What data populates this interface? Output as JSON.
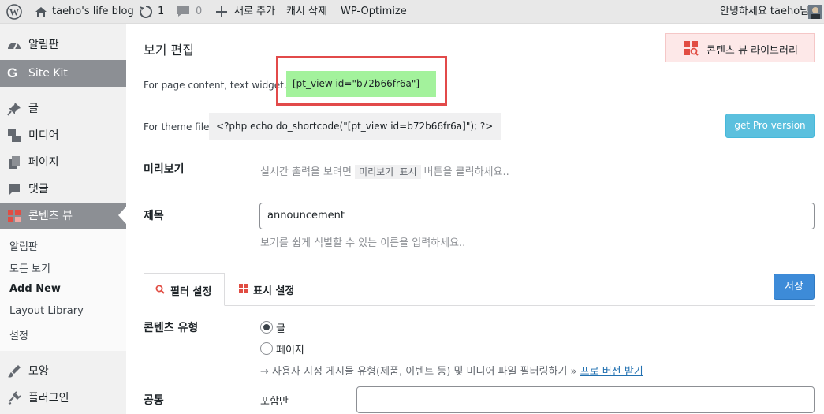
{
  "adminbar": {
    "site_name": "taeho's life blog",
    "updates_count": "1",
    "comments_count": "0",
    "new_label": "새로 추가",
    "cache_label": "캐시 삭제",
    "wpo_label": "WP-Optimize",
    "greeting": "안녕하세요 taeho님"
  },
  "sidebar": {
    "items": [
      {
        "label": "알림판",
        "icon": "dashboard-icon"
      },
      {
        "label": "Site Kit",
        "icon": "sitekit-icon"
      },
      {
        "label": "글",
        "icon": "pin-icon"
      },
      {
        "label": "미디어",
        "icon": "media-icon"
      },
      {
        "label": "페이지",
        "icon": "page-icon"
      },
      {
        "label": "댓글",
        "icon": "comment-icon"
      },
      {
        "label": "콘텐츠 뷰",
        "icon": "content-views-icon"
      },
      {
        "label": "모양",
        "icon": "brush-icon"
      },
      {
        "label": "플러그인",
        "icon": "plugin-icon"
      }
    ],
    "submenu": [
      "알림판",
      "모든 보기",
      "Add New",
      "Layout Library",
      "설정"
    ]
  },
  "main": {
    "title": "보기 편집",
    "library_button": "콘텐츠 뷰 라이브러리",
    "page_content_label": "For page content, text widget..",
    "shortcode": "[pt_view id=\"b72b66fr6a\"]",
    "theme_file_label": "For theme file",
    "theme_code": "<?php echo do_shortcode(\"[pt_view id=b72b66fr6a]\"); ?>",
    "pro_button": "get Pro version",
    "preview": {
      "label": "미리보기",
      "hint_before": "실시간 출력을 보려면",
      "hint_kbd": "미리보기 표시",
      "hint_after": "버튼을 클릭하세요.."
    },
    "title_field": {
      "label": "제목",
      "value": "announcement",
      "hint": "보기를 쉽게 식별할 수 있는 이름을 입력하세요.."
    },
    "tabs": [
      {
        "label": "필터 설정",
        "icon": "search-icon",
        "active": true
      },
      {
        "label": "표시 설정",
        "icon": "grid-icon",
        "active": false
      }
    ],
    "save_button": "저장",
    "content_type": {
      "label": "콘텐츠 유형",
      "options": [
        "글",
        "페이지"
      ],
      "selected": "글",
      "pro_hint": "→ 사용자 지정 게시물 유형(제품, 이벤트 등) 및 미디어 파일 필터링하기 »",
      "pro_link": "프로 버전 받기"
    },
    "common": {
      "label": "공통",
      "include_label": "포함만"
    }
  },
  "colors": {
    "shortcode_bg": "#a3f29c",
    "highlight_border": "#e24a4a",
    "pro_button": "#5bc0de",
    "save_button": "#3d8bd8",
    "link": "#2271b1"
  }
}
